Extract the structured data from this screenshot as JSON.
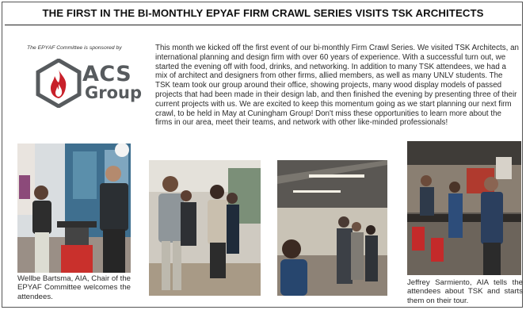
{
  "headline": "THE FIRST IN THE BI-MONTHLY EPYAF FIRM CRAWL SERIES VISITS TSK ARCHITECTS",
  "sponsor": {
    "caption": "The EPYAF Committee is sponsored by",
    "logo_line1": "ACS",
    "logo_line2": "Group"
  },
  "article_text": "This month we kicked off the first event of our bi-monthly Firm Crawl Series. We visited TSK Architects, an international planning and design firm with over 60 years of experience. With a successful turn out, we started the evening off with food, drinks, and networking. In addition to many TSK attendees, we had a mix of architect and designers from other firms, allied members, as well as many UNLV students. The TSK team took our group around their office, showing projects, many wood display models of passed projects that had been made in their design lab, and then finished the evening by presenting three of their current projects with us. We are excited to keep this momentum going as we start planning our next firm crawl, to be held in May at Cuningham Group! Don't miss these opportunities to learn more about the firms in our area, meet their teams, and network with other like-minded professionals!",
  "captions": {
    "left": "Wellbe Bartsma, AIA, Chair of the EPYAF Committee welcomes the attendees.",
    "right": "Jeffrey Sarmiento, AIA tells the attendees about TSK and starts them on their tour."
  },
  "colors": {
    "logo_gray": "#575b5e",
    "logo_red": "#c8202a",
    "text": "#2a2a2a"
  }
}
